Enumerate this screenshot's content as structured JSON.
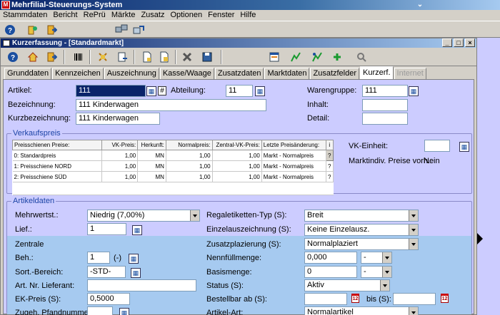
{
  "app": {
    "title": "Mehrfilial-Steuerungs-System"
  },
  "menu": [
    "Stammdaten",
    "Bericht",
    "RePrü",
    "Märkte",
    "Zusatz",
    "Optionen",
    "Fenster",
    "Hilfe"
  ],
  "window": {
    "title": "Kurzerfassung - [Standardmarkt]",
    "min": "_",
    "max": "□",
    "close": "×"
  },
  "tabs": [
    "Grunddaten",
    "Kennzeichen",
    "Auszeichnung",
    "Kasse/Waage",
    "Zusatzdaten",
    "Marktdaten",
    "Zusatzfelder",
    "Kurzerf.",
    "Internet"
  ],
  "tabs_state": {
    "active": "Kurzerf.",
    "disabled": "Internet"
  },
  "top": {
    "artikel_label": "Artikel:",
    "artikel_value": "111",
    "abteilung_label": "Abteilung:",
    "abteilung_value": "11",
    "warengruppe_label": "Warengruppe:",
    "warengruppe_value": "111",
    "bezeichnung_label": "Bezeichnung:",
    "bezeichnung_value": "111 Kinderwagen",
    "inhalt_label": "Inhalt:",
    "inhalt_value": "",
    "kurzbezeichnung_label": "Kurzbezeichnung:",
    "kurzbezeichnung_value": "111 Kinderwagen",
    "detail_label": "Detail:",
    "detail_value": ""
  },
  "verkaufspreis": {
    "title": "Verkaufspreis",
    "columns": [
      "Preisschienen Preise:",
      "VK-Preis:",
      "Herkunft:",
      "Normalpreis:",
      "Zentral-VK-Preis:",
      "Letzte Preisänderung:",
      "i"
    ],
    "rows": [
      {
        "schiene": "0: Standardpreis",
        "vk": "1,00",
        "herkunft": "MN",
        "normal": "1,00",
        "zentral": "1,00",
        "aenderung": "Markt - Normalpreis",
        "i": "?"
      },
      {
        "schiene": "1: Preisschiene NORD",
        "vk": "1,00",
        "herkunft": "MN",
        "normal": "1,00",
        "zentral": "1,00",
        "aenderung": "Markt - Normalpreis",
        "i": "?"
      },
      {
        "schiene": "2: Preisschiene SÜD",
        "vk": "1,00",
        "herkunft": "MN",
        "normal": "1,00",
        "zentral": "1,00",
        "aenderung": "Markt - Normalpreis",
        "i": "?"
      }
    ],
    "vk_einheit_label": "VK-Einheit:",
    "vk_einheit_value": "",
    "marktindiv_label": "Marktindiv. Preise vorh.:",
    "marktindiv_value": "Nein"
  },
  "artikeldaten": {
    "title": "Artikeldaten",
    "mehrwertst_label": "Mehrwertst.:",
    "mehrwertst_value": "Niedrig (7,00%)",
    "lief_label": "Lief.:",
    "lief_value": "1",
    "regaletiketten_label": "Regaletiketten-Typ (S):",
    "regaletiketten_value": "Breit",
    "einzelauszeichnung_label": "Einzelauszeichnung (S):",
    "einzelauszeichnung_value": "Keine Einzelausz.",
    "zusatzplazierung_label": "Zusatzplazierung (S):",
    "zusatzplazierung_value": "Normalplaziert",
    "zentrale_label": "Zentrale",
    "beh_label": "Beh.:",
    "beh_value": "1",
    "beh_unit": "(-)",
    "nennfuell_label": "Nennfüllmenge:",
    "nennfuell_value": "0,000",
    "nennfuell_unit": "-",
    "sort_label": "Sort.-Bereich:",
    "sort_value": "-STD-",
    "basismenge_label": "Basismenge:",
    "basismenge_value": "0",
    "basismenge_unit": "-",
    "artnr_label": "Art. Nr. Lieferant:",
    "artnr_value": "",
    "status_label": "Status (S):",
    "status_value": "Aktiv",
    "ek_label": "EK-Preis (S):",
    "ek_value": "0,5000",
    "bestellbar_label": "Bestellbar ab (S):",
    "bestellbar_value": "",
    "bis_label": "bis (S):",
    "bis_value": "",
    "pfand_label": "Zugeh. Pfandnummer:",
    "pfand_value": "",
    "artikelart_label": "Artikel-Art:",
    "artikelart_value": "Normalartikel",
    "cal_glyph": "12"
  }
}
